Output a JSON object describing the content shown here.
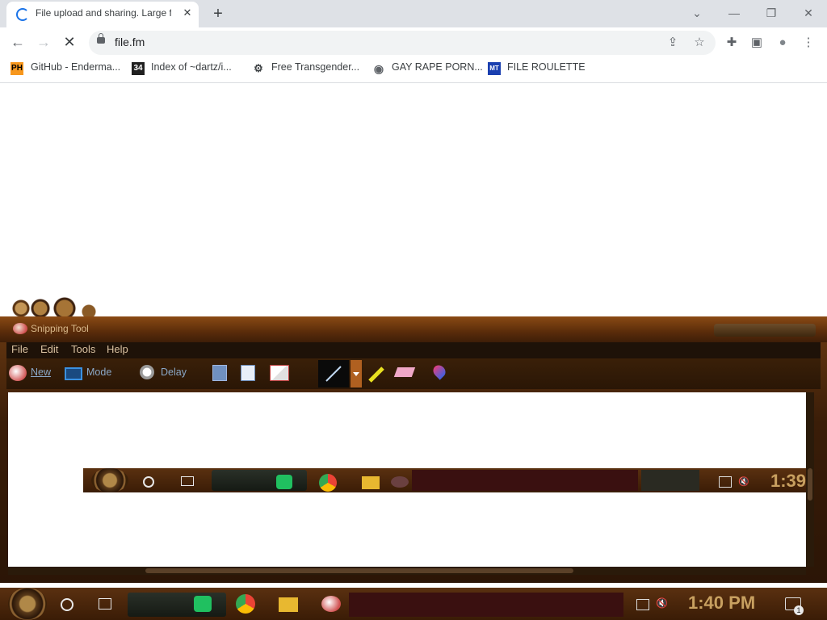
{
  "browser": {
    "tab": {
      "title": "File upload and sharing. Large f",
      "close": "✕"
    },
    "new_tab": "+",
    "window_controls": {
      "dropdown": "⌄",
      "minimize": "—",
      "restore": "❐",
      "close": "✕"
    },
    "nav": {
      "back": "←",
      "forward": "→",
      "stop": "✕"
    },
    "url": "file.fm",
    "toolbar_icons": {
      "share": "⇪",
      "star": "☆",
      "extensions": "✚",
      "sidepanel": "▣",
      "profile": "●",
      "menu": "⋮"
    },
    "bookmarks": [
      {
        "icon": "PH",
        "label": "GitHub - Enderma..."
      },
      {
        "icon": "34",
        "label": "Index of ~dartz/i..."
      },
      {
        "icon": "⚙",
        "label": "Free Transgender..."
      },
      {
        "icon": "◉",
        "label": "GAY RAPE PORN..."
      },
      {
        "icon": "MT",
        "label": "FILE ROULETTE"
      }
    ]
  },
  "snipping_tool": {
    "title": "Snipping Tool",
    "menu": [
      "File",
      "Edit",
      "Tools",
      "Help"
    ],
    "toolbar": {
      "new": "New",
      "mode": "Mode",
      "delay": "Delay"
    },
    "captured_clock": "1:39"
  },
  "taskbar": {
    "clock": "1:40 PM",
    "notifications": "1"
  }
}
